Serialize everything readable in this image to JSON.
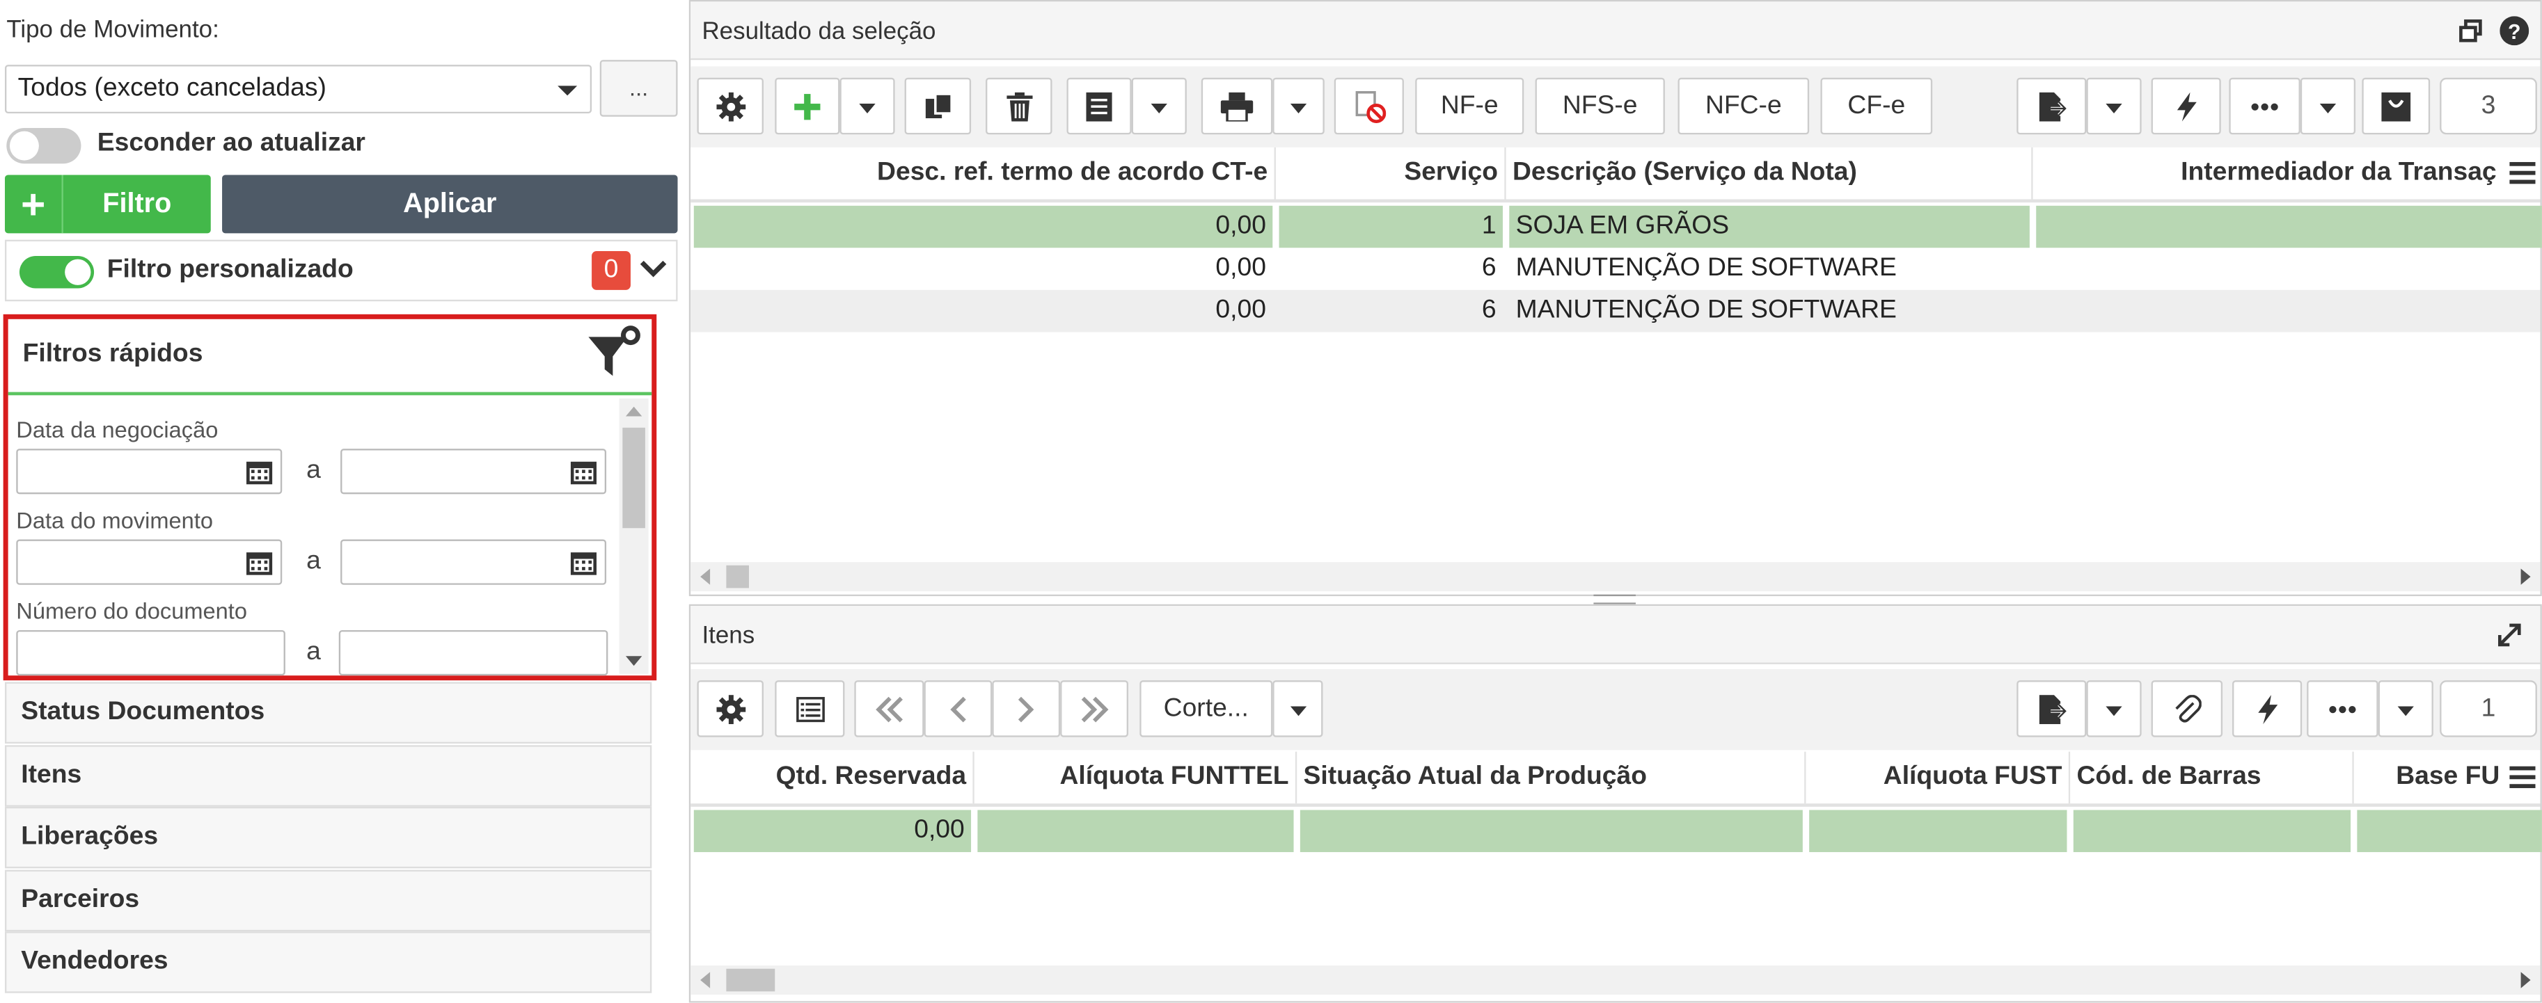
{
  "left": {
    "tipo_label": "Tipo de Movimento:",
    "tipo_value": "Todos (exceto canceladas)",
    "dots_label": "...",
    "esconder_label": "Esconder ao atualizar",
    "filtro_label": "Filtro",
    "aplicar_label": "Aplicar",
    "filtro_personalizado_label": "Filtro personalizado",
    "filtro_personalizado_count": "0",
    "quick": {
      "title": "Filtros rápidos",
      "separator": "a",
      "fields": [
        {
          "label": "Data da negociação"
        },
        {
          "label": "Data do movimento"
        },
        {
          "label": "Número do documento"
        }
      ]
    },
    "accordion": [
      "Status Documentos",
      "Itens",
      "Liberações",
      "Parceiros",
      "Vendedores"
    ]
  },
  "result": {
    "title": "Resultado da seleção",
    "buttons": {
      "nfe": "NF-e",
      "nfse": "NFS-e",
      "nfce": "NFC-e",
      "cfe": "CF-e"
    },
    "count": "3",
    "columns": [
      "Desc. ref. termo de acordo CT-e",
      "Serviço",
      "Descrição (Serviço da Nota)",
      "Intermediador da Transaç"
    ],
    "rows": [
      [
        "0,00",
        "1",
        "SOJA EM GRÃOS",
        ""
      ],
      [
        "0,00",
        "6",
        "MANUTENÇÃO DE SOFTWARE",
        ""
      ],
      [
        "0,00",
        "6",
        "MANUTENÇÃO DE SOFTWARE",
        ""
      ]
    ]
  },
  "itens": {
    "title": "Itens",
    "corte_label": "Corte...",
    "count": "1",
    "columns": [
      "Qtd. Reservada",
      "Alíquota FUNTTEL",
      "Situação Atual da Produção",
      "Alíquota FUST",
      "Cód. de Barras",
      "Base FU"
    ],
    "rows": [
      [
        "0,00",
        "",
        "",
        "",
        "",
        ""
      ]
    ]
  },
  "colors": {
    "green": "#43b84a",
    "dark": "#4e5a67",
    "red": "#e74c3c",
    "selected_row": "#b8d7b3"
  }
}
